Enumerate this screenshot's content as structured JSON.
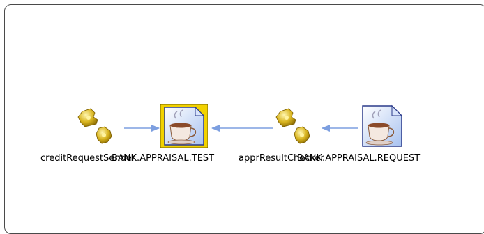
{
  "diagram": {
    "nodes": [
      {
        "id": "creditRequestSender",
        "label": "creditRequestSender",
        "kind": "component",
        "icon": "gear-component-icon"
      },
      {
        "id": "bank_appraisal_test",
        "label": "BANK.APPRAISAL.TEST",
        "kind": "queue",
        "icon": "java-document-icon",
        "selected": true
      },
      {
        "id": "apprResultChecker",
        "label": "apprResultChecker",
        "kind": "component",
        "icon": "gear-component-icon"
      },
      {
        "id": "bank_appraisal_request",
        "label": "BANK.APPRAISAL.REQUEST",
        "kind": "queue",
        "icon": "java-document-icon"
      }
    ],
    "edges": [
      {
        "from": "creditRequestSender",
        "to": "bank_appraisal_test"
      },
      {
        "from": "apprResultChecker",
        "to": "bank_appraisal_test"
      },
      {
        "from": "bank_appraisal_request",
        "to": "apprResultChecker"
      }
    ],
    "colors": {
      "arrow": "#7d9fe0",
      "selection": "#f2d200",
      "border": "#4a4a4a"
    }
  }
}
